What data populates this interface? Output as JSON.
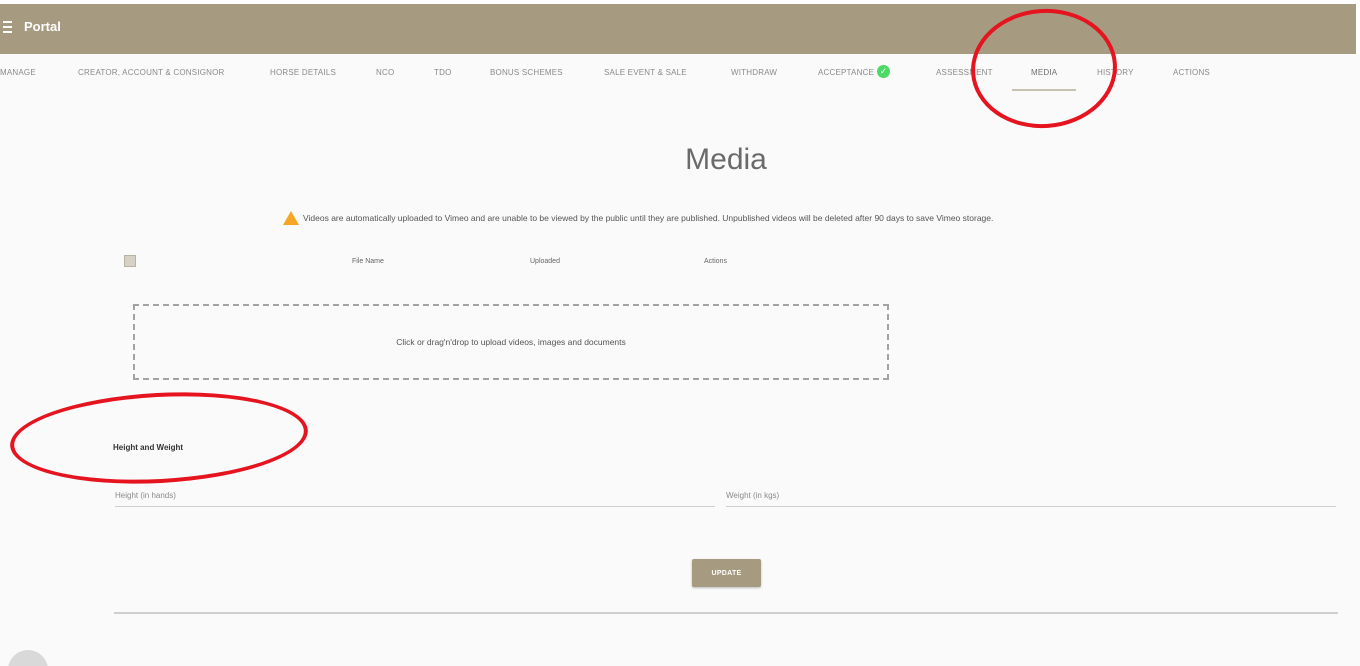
{
  "header": {
    "app_title": "Portal",
    "background": "#a69a80"
  },
  "tabs": [
    {
      "label": "MANAGE"
    },
    {
      "label": "CREATOR, ACCOUNT & CONSIGNOR"
    },
    {
      "label": "HORSE DETAILS"
    },
    {
      "label": "NCO"
    },
    {
      "label": "TDO"
    },
    {
      "label": "BONUS SCHEMES"
    },
    {
      "label": "SALE EVENT & SALE"
    },
    {
      "label": "WITHDRAW"
    },
    {
      "label": "ACCEPTANCE"
    },
    {
      "label": "ASSESSMENT"
    },
    {
      "label": "MEDIA"
    },
    {
      "label": "HISTORY"
    },
    {
      "label": "ACTIONS"
    }
  ],
  "active_tab": "MEDIA",
  "main": {
    "title": "Media",
    "notice": "Videos are automatically uploaded to Vimeo and are unable to be viewed by the public until they are published. Unpublished videos will be deleted after 90 days to save Vimeo storage.",
    "table_headers": {
      "file_name": "File Name",
      "uploaded": "Uploaded",
      "actions": "Actions"
    },
    "dropzone_text": "Click or drag'n'drop to upload videos, images and documents",
    "height_weight": {
      "title": "Height and Weight",
      "height_placeholder": "Height (in hands)",
      "weight_placeholder": "Weight (in kgs)"
    },
    "update_label": "UPDATE"
  },
  "colors": {
    "accent": "#a69a80",
    "annotation": "#e5141f",
    "success": "#4cd964",
    "warning": "#f5a623"
  }
}
